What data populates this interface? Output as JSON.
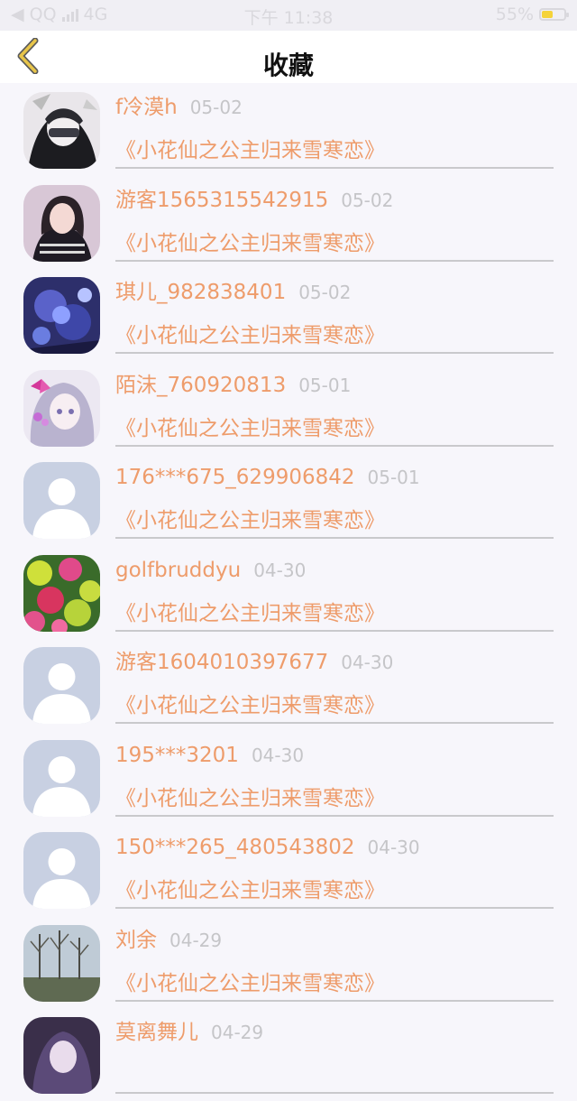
{
  "status_bar": {
    "carrier": "QQ",
    "network": "4G",
    "time": "下午 11:38",
    "battery": "55%",
    "battery_level": 0.55
  },
  "nav": {
    "title": "收藏"
  },
  "favorites": [
    {
      "username": "f冷漠h",
      "date": "05-02",
      "title": "《小花仙之公主归来雪寒恋》",
      "avatar": "anime-mask"
    },
    {
      "username": "游客1565315542915",
      "date": "05-02",
      "title": "《小花仙之公主归来雪寒恋》",
      "avatar": "girl-photo"
    },
    {
      "username": "琪儿_982838401",
      "date": "05-02",
      "title": "《小花仙之公主归来雪寒恋》",
      "avatar": "blue-flower"
    },
    {
      "username": "陌沫_760920813",
      "date": "05-01",
      "title": "《小花仙之公主归来雪寒恋》",
      "avatar": "anime-girl"
    },
    {
      "username": "176***675_629906842",
      "date": "05-01",
      "title": "《小花仙之公主归来雪寒恋》",
      "avatar": "default"
    },
    {
      "username": "golfbruddyu",
      "date": "04-30",
      "title": "《小花仙之公主归来雪寒恋》",
      "avatar": "flowers"
    },
    {
      "username": "游客1604010397677",
      "date": "04-30",
      "title": "《小花仙之公主归来雪寒恋》",
      "avatar": "default"
    },
    {
      "username": "195***3201",
      "date": "04-30",
      "title": "《小花仙之公主归来雪寒恋》",
      "avatar": "default"
    },
    {
      "username": "150***265_480543802",
      "date": "04-30",
      "title": "《小花仙之公主归来雪寒恋》",
      "avatar": "default"
    },
    {
      "username": "刘余",
      "date": "04-29",
      "title": "《小花仙之公主归来雪寒恋》",
      "avatar": "trees"
    },
    {
      "username": "莫离舞儿",
      "date": "04-29",
      "title": "",
      "avatar": "anime-dark"
    }
  ],
  "colors": {
    "accent": "#ee9c6b",
    "date": "#c5c5c8",
    "divider": "#c9c9cc",
    "back_icon": "#e8c54a"
  }
}
